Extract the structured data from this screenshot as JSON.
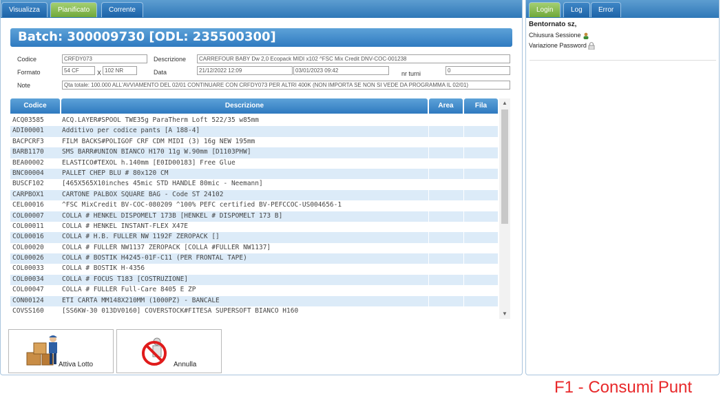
{
  "tabs": [
    "Visualizza",
    "Pianificato",
    "Corrente"
  ],
  "right_tabs": [
    "Login",
    "Log",
    "Error"
  ],
  "batch_title": "Batch: 300009730 [ODL: 235500300]",
  "form": {
    "codice_label": "Codice",
    "codice": "CRFDY073",
    "descrizione_label": "Descrizione",
    "descrizione": "CARREFOUR BABY Dw 2,0 Ecopack MIDI x102 ^FSC Mix Credit DNV-COC-001238",
    "formato_label": "Formato",
    "formato": "54 CF",
    "x": "X",
    "nr": "102 NR",
    "data_label": "Data",
    "data_start": "21/12/2022 12:09",
    "data_end": "03/01/2023 09:42",
    "nr_turni_label": "nr turni",
    "nr_turni": "0",
    "note_label": "Note",
    "note": "Qta totale: 100.000 ALL'AVVIAMENTO DEL 02/01 CONTINUARE CON CRFDY073 PER ALTRI 400K (NON IMPORTA SE NON SI VEDE DA PROGRAMMA IL 02/01)"
  },
  "grid": {
    "headers": [
      "Codice",
      "Descrizione",
      "Area",
      "Fila"
    ],
    "rows": [
      {
        "code": "ACQ03585",
        "desc": "ACQ.LAYER#SPOOL TWE35g ParaTherm Loft 522/35 w85mm"
      },
      {
        "code": "ADI00001",
        "desc": "Additivo per codice pants [A 188-4]"
      },
      {
        "code": "BACPCRF3",
        "desc": "FILM BACKS#POLIGOF CRF CDM MIDI (3) 16g NEW 195mm"
      },
      {
        "code": "BARB1170",
        "desc": "SMS BARR#UNION BIANCO H170 11g W.90mm [D1103PHW]"
      },
      {
        "code": "BEA00002",
        "desc": "ELASTICO#TEXOL h.140mm [E0ID00183] Free Glue"
      },
      {
        "code": "BNC00004",
        "desc": "PALLET CHEP BLU # 80x120 CM"
      },
      {
        "code": "BUSCF102",
        "desc": "[465X565X10inches 45mic STD HANDLE 80mic - Neemann]"
      },
      {
        "code": "CARPBOX1",
        "desc": "CARTONE PALBOX SQUARE BAG - Code ST 24102"
      },
      {
        "code": "CEL00016",
        "desc": "^FSC MixCredit BV-COC-080209 ^100% PEFC certified BV-PEFCCOC-US004656-1"
      },
      {
        "code": "COL00007",
        "desc": "COLLA # HENKEL DISPOMELT 173B [HENKEL # DISPOMELT 173 B]"
      },
      {
        "code": "COL00011",
        "desc": "COLLA # HENKEL INSTANT-FLEX X47E"
      },
      {
        "code": "COL00016",
        "desc": "COLLA # H.B. FULLER NW 1192F ZEROPACK []"
      },
      {
        "code": "COL00020",
        "desc": "COLLA # FULLER NW1137 ZEROPACK [COLLA #FULLER NW1137]"
      },
      {
        "code": "COL00026",
        "desc": "COLLA # BOSTIK H4245-01F-C11 (PER FRONTAL TAPE)"
      },
      {
        "code": "COL00033",
        "desc": "COLLA # BOSTIK H-4356"
      },
      {
        "code": "COL00034",
        "desc": "COLLA # FOCUS T183 [COSTRUZIONE]"
      },
      {
        "code": "COL00047",
        "desc": "COLLA # FULLER Full-Care 8405 E ZP"
      },
      {
        "code": "CON00124",
        "desc": "ETI CARTA MM148X210MM (1000PZ) - BANCALE"
      },
      {
        "code": "COVSS160",
        "desc": "[SS6KW-30 013DV0160] COVERSTOCK#FITESA SUPERSOFT BIANCO H160"
      }
    ]
  },
  "buttons": {
    "activate": "Attiva Lotto",
    "cancel": "Annulla"
  },
  "login": {
    "welcome": "Bentornato sz,",
    "logout": "Chiusura Sessione",
    "change_password": "Variazione Password"
  },
  "footer": "F1 - Consumi Punt"
}
